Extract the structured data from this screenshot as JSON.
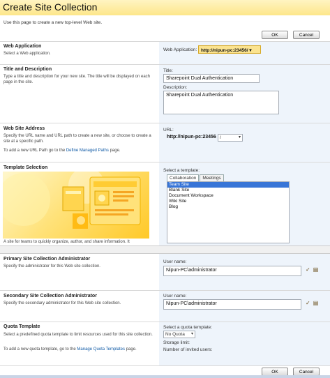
{
  "header": {
    "title": "Create Site Collection"
  },
  "intro": "Use this page to create a new top-level Web site.",
  "buttons": {
    "ok": "OK",
    "cancel": "Cancel"
  },
  "web_application": {
    "title": "Web Application",
    "desc": "Select a Web application.",
    "label": "Web Application:",
    "value": "http://nipun-pc:23456/"
  },
  "title_description": {
    "title": "Title and Description",
    "desc": "Type a title and description for your new site. The title will be displayed on each page in the site.",
    "title_label": "Title:",
    "title_value": "Sharepoint Dual Authentication",
    "desc_label": "Description:",
    "desc_value": "Sharepoint Dual Authentication"
  },
  "web_address": {
    "title": "Web Site Address",
    "desc": "Specify the URL name and URL path to create a new site, or choose to create a site at a specific path.",
    "managed_pre": "To add a new URL Path go to the",
    "managed_link": "Define Managed Paths",
    "managed_post": "page.",
    "url_label": "URL:",
    "url_prefix": "http://nipun-pc:23456",
    "url_path": "/"
  },
  "template": {
    "title": "Template Selection",
    "select_label": "Select a template:",
    "tabs": [
      "Collaboration",
      "Meetings"
    ],
    "items": [
      "Team Site",
      "Blank Site",
      "Document Workspace",
      "Wiki Site",
      "Blog"
    ],
    "caption": "A site for teams to quickly organize, author, and share information. It"
  },
  "primary_admin": {
    "title": "Primary Site Collection Administrator",
    "desc": "Specify the administrator for this Web site collection.",
    "label": "User name:",
    "value": "Nipun-PC\\administrator"
  },
  "secondary_admin": {
    "title": "Secondary Site Collection Administrator",
    "desc": "Specify the secondary administrator for this Web site collection.",
    "label": "User name:",
    "value": "Nipun-PC\\administrator"
  },
  "quota": {
    "title": "Quota Template",
    "desc": "Select a predefined quota template to limit resources used for this site collection.",
    "link_pre": "To add a new quota template, go to the",
    "link": "Manage Quota Templates",
    "link_post": "page.",
    "select_label": "Select a quota template:",
    "select_value": "No Quota",
    "storage_label": "Storage limit:",
    "users_label": "Number of invited users:"
  },
  "icons": {
    "check_names": "check-names-icon",
    "browse": "address-book-icon"
  }
}
